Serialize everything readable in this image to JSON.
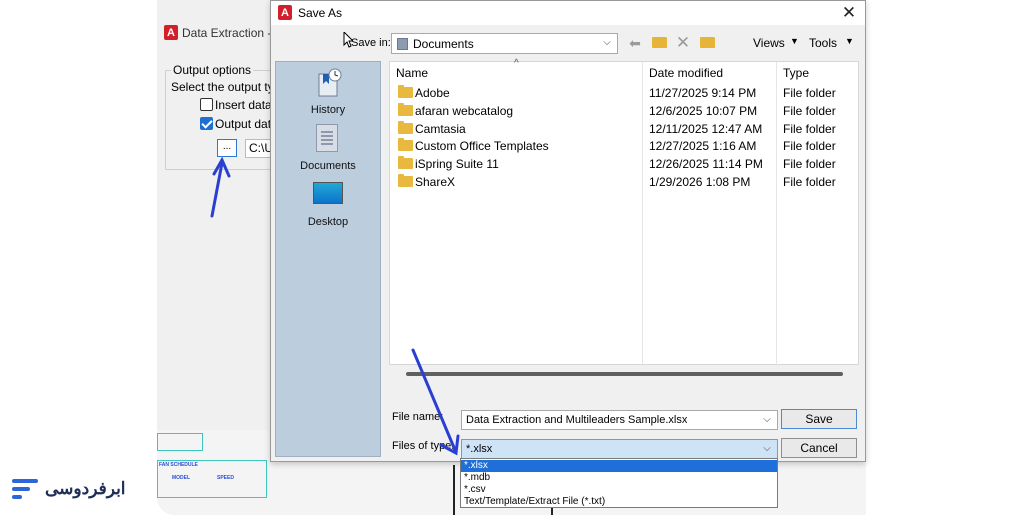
{
  "background_app": {
    "title": "Data Extraction - (",
    "group_label": "Output options",
    "prompt": "Select the output type",
    "option_insert": "Insert data e",
    "option_output": "Output data",
    "browse_label": "...",
    "path_value": "C:\\U",
    "drawing_table_title": "FAN SCHEDULE",
    "drawing_col_1": "MODEL",
    "drawing_col_2": "SPEED"
  },
  "dialog": {
    "title": "Save As",
    "close_glyph": "✕",
    "save_in_label": "Save in:",
    "save_in_value": "Documents",
    "toolbar": {
      "back_glyph": "⬅",
      "delete_glyph": "✕",
      "views_label": "Views",
      "tools_label": "Tools",
      "dropdown_glyph": "▼"
    },
    "places": [
      {
        "label": "History",
        "icon": "history-icon"
      },
      {
        "label": "Documents",
        "icon": "documents-icon"
      },
      {
        "label": "Desktop",
        "icon": "desktop-icon"
      }
    ],
    "columns": [
      "Name",
      "Date modified",
      "Type"
    ],
    "sort_glyph": "^",
    "files": [
      {
        "name": "Adobe",
        "date": "11/27/2025 9:14 PM",
        "type": "File folder"
      },
      {
        "name": "afaran webcatalog",
        "date": "12/6/2025 10:07 PM",
        "type": "File folder"
      },
      {
        "name": "Camtasia",
        "date": "12/11/2025 12:47 AM",
        "type": "File folder"
      },
      {
        "name": "Custom Office Templates",
        "date": "12/27/2025 1:16 AM",
        "type": "File folder"
      },
      {
        "name": "iSpring Suite 11",
        "date": "12/26/2025 11:14 PM",
        "type": "File folder"
      },
      {
        "name": "ShareX",
        "date": "1/29/2026 1:08 PM",
        "type": "File folder"
      }
    ],
    "file_name_label": "File name:",
    "file_name_value": "Data Extraction and Multileaders Sample.xlsx",
    "files_of_type_label": "Files of type:",
    "files_of_type_value": "*.xlsx",
    "save_button": "Save",
    "cancel_button": "Cancel",
    "type_options": [
      "*.xlsx",
      "*.mdb",
      "*.csv",
      "Text/Template/Extract File (*.txt)"
    ],
    "combo_glyph": "⌵"
  },
  "brand": {
    "name": "ابرفردوسی",
    "accent_color": "#2c66d8"
  },
  "annotation_color": "#2a3fd1"
}
